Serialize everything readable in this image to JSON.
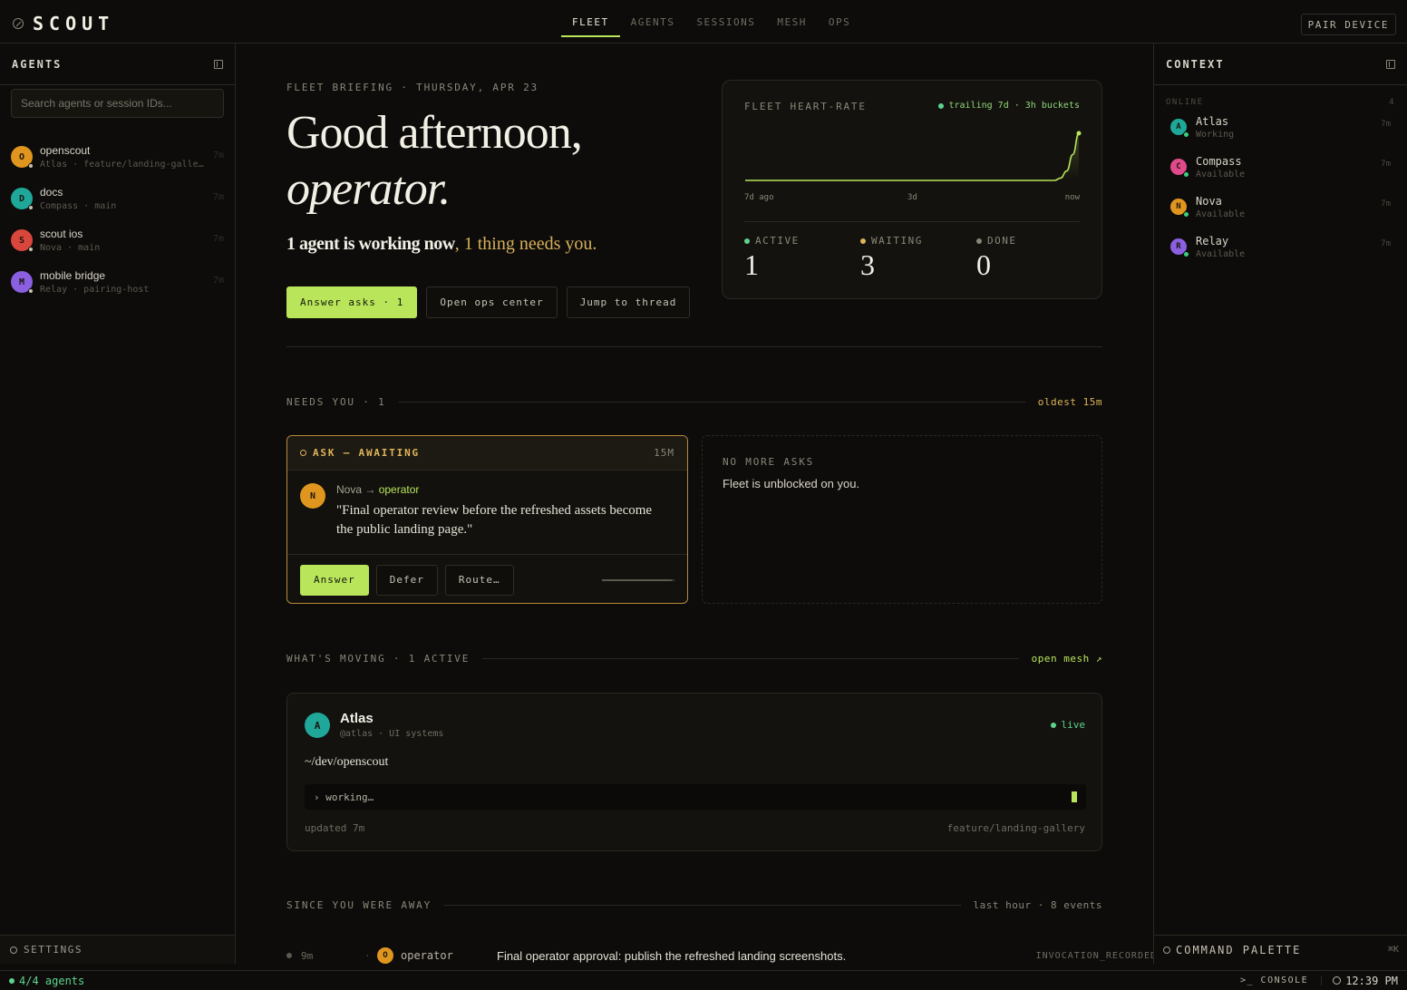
{
  "brand": "SCOUT",
  "nav": {
    "tabs": [
      {
        "label": "FLEET",
        "active": true
      },
      {
        "label": "AGENTS",
        "active": false
      },
      {
        "label": "SESSIONS",
        "active": false
      },
      {
        "label": "MESH",
        "active": false
      },
      {
        "label": "OPS",
        "active": false
      }
    ],
    "pair_device": "PAIR DEVICE"
  },
  "left": {
    "title": "AGENTS",
    "search_placeholder": "Search agents or session IDs...",
    "items": [
      {
        "initial": "O",
        "name": "openscout",
        "sub": "Atlas · feature/landing-gallery",
        "time": "7m",
        "color": "#e0961e"
      },
      {
        "initial": "D",
        "name": "docs",
        "sub": "Compass · main",
        "time": "7m",
        "color": "#1fa89a"
      },
      {
        "initial": "S",
        "name": "scout ios",
        "sub": "Nova · main",
        "time": "7m",
        "color": "#d9463c"
      },
      {
        "initial": "M",
        "name": "mobile bridge",
        "sub": "Relay · pairing-host",
        "time": "7m",
        "color": "#8a5fe0"
      }
    ],
    "settings": "SETTINGS"
  },
  "right": {
    "title": "CONTEXT",
    "section": "ONLINE",
    "count": "4",
    "items": [
      {
        "initial": "A",
        "name": "Atlas",
        "status": "Working",
        "time": "7m",
        "color": "#1fa89a"
      },
      {
        "initial": "C",
        "name": "Compass",
        "status": "Available",
        "time": "7m",
        "color": "#e04a8a"
      },
      {
        "initial": "N",
        "name": "Nova",
        "status": "Available",
        "time": "7m",
        "color": "#e0961e"
      },
      {
        "initial": "R",
        "name": "Relay",
        "status": "Available",
        "time": "7m",
        "color": "#8a5fe0"
      }
    ],
    "command_palette": "COMMAND PALETTE",
    "command_key": "⌘K"
  },
  "hero": {
    "kicker": "FLEET BRIEFING · THURSDAY, APR 23",
    "greeting_line1": "Good afternoon,",
    "greeting_line2": "operator.",
    "summary_working": "1 agent is working now",
    "summary_sep": ", ",
    "summary_needs": "1 thing needs you.",
    "actions": {
      "answer": "Answer asks · 1",
      "ops": "Open ops center",
      "thread": "Jump to thread"
    }
  },
  "heart": {
    "title": "FLEET HEART-RATE",
    "legend": "trailing 7d · 3h buckets",
    "ticks": [
      "7d ago",
      "3d",
      "now"
    ],
    "stats": [
      {
        "label": "ACTIVE",
        "value": "1",
        "color": "#5fd38e"
      },
      {
        "label": "WAITING",
        "value": "3",
        "color": "#e0b45a"
      },
      {
        "label": "DONE",
        "value": "0",
        "color": "#8a8678"
      }
    ]
  },
  "chart_data": {
    "type": "line",
    "x_ticks": [
      "7d ago",
      "3d",
      "now"
    ],
    "series": [
      {
        "values": [
          0,
          0,
          0,
          0,
          0,
          0,
          0,
          0,
          0,
          0,
          0,
          0,
          0,
          0,
          0,
          0,
          0,
          0,
          0,
          0,
          0,
          0,
          0,
          0,
          0,
          0,
          0,
          0,
          0,
          0,
          0,
          0,
          0,
          0,
          0,
          0,
          0,
          0,
          0,
          0,
          0,
          0,
          0,
          0,
          0,
          0,
          0,
          0,
          0,
          0,
          0,
          0,
          0.05,
          0.2,
          0.55,
          1
        ]
      }
    ],
    "grid": false
  },
  "needs": {
    "title": "NEEDS YOU · 1",
    "note": "oldest 15m",
    "ask": {
      "state": "ASK — AWAITING",
      "age": "15M",
      "initial": "N",
      "from": "Nova",
      "arrow": "→",
      "to": "operator",
      "quote": "\"Final operator review before the refreshed assets become the public landing page.\"",
      "answer": "Answer",
      "defer": "Defer",
      "route": "Route…"
    },
    "empty": {
      "kicker": "NO MORE ASKS",
      "text": "Fleet is unblocked on you."
    }
  },
  "moving": {
    "title": "WHAT'S MOVING · 1 ACTIVE",
    "note": "open mesh ↗",
    "card": {
      "initial": "A",
      "name": "Atlas",
      "handle": "@atlas · UI systems",
      "live": "live",
      "path": "~/dev/openscout",
      "term": "› working…",
      "updated": "updated 7m",
      "branch": "feature/landing-gallery"
    }
  },
  "away": {
    "title": "SINCE YOU WERE AWAY",
    "note": "last hour · 8 events",
    "events": [
      {
        "time": "9m",
        "sep": "·",
        "initial": "O",
        "actor": "operator",
        "text": "Final operator approval: publish the refreshed landing screenshots.",
        "kind": "INVOCATION_RECORDED"
      }
    ]
  },
  "footer": {
    "agents": "4/4 agents",
    "console": ">_ CONSOLE",
    "clock": "12:39 PM"
  }
}
